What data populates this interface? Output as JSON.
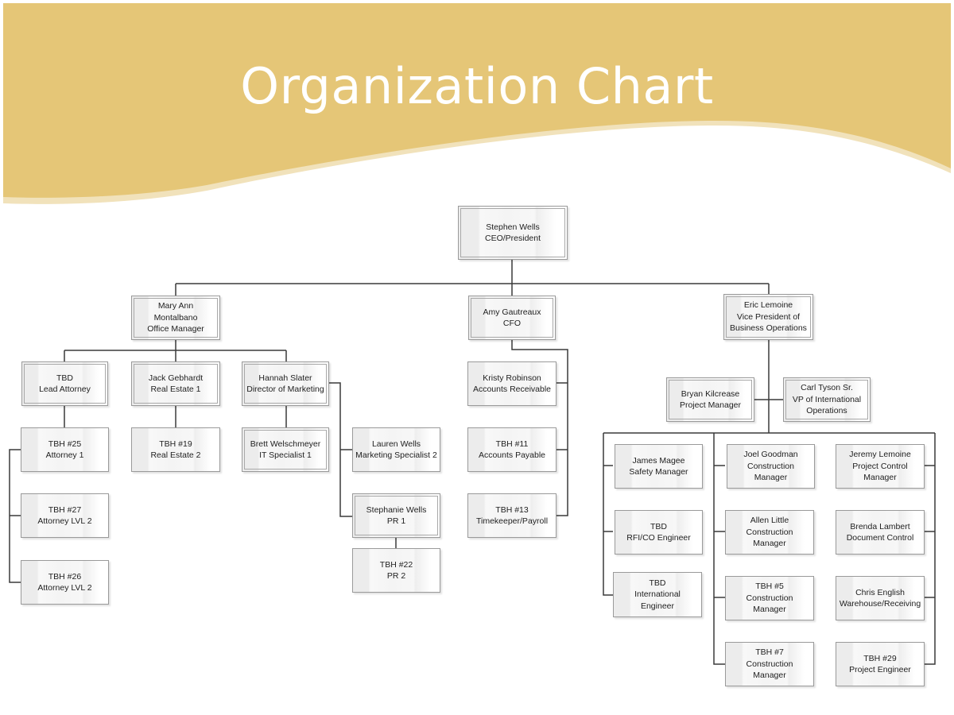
{
  "title": "Organization Chart",
  "colors": {
    "banner": "#e5c677",
    "banner_edge": "#f1e2bb",
    "connector": "#3a3a3a",
    "text": "#222222"
  },
  "nodes": [
    {
      "id": "ceo",
      "name": "Stephen Wells",
      "role": "CEO/President",
      "text": "Stephen Wells\nCEO/President"
    },
    {
      "id": "office-manager",
      "name": "Mary Ann Montalbano",
      "role": "Office Manager",
      "text": "Mary Ann\nMontalbano\nOffice Manager"
    },
    {
      "id": "cfo",
      "name": "Amy Gautreaux",
      "role": "CFO",
      "text": "Amy Gautreaux\nCFO"
    },
    {
      "id": "vp-business-ops",
      "name": "Eric Lemoine",
      "role": "Vice President of Business Operations",
      "text": "Eric Lemoine\nVice President of\nBusiness Operations"
    },
    {
      "id": "lead-attorney",
      "name": "TBD",
      "role": "Lead Attorney",
      "text": "TBD\nLead Attorney"
    },
    {
      "id": "real-estate-1",
      "name": "Jack Gebhardt",
      "role": "Real Estate 1",
      "text": "Jack Gebhardt\nReal Estate 1"
    },
    {
      "id": "director-marketing",
      "name": "Hannah Slater",
      "role": "Director of Marketing",
      "text": "Hannah Slater\nDirector of Marketing"
    },
    {
      "id": "attorney-1",
      "name": "TBH #25",
      "role": "Attorney 1",
      "text": "TBH #25\nAttorney 1"
    },
    {
      "id": "attorney-lvl2-a",
      "name": "TBH #27",
      "role": "Attorney LVL 2",
      "text": "TBH #27\nAttorney LVL 2"
    },
    {
      "id": "attorney-lvl2-b",
      "name": "TBH #26",
      "role": "Attorney LVL 2",
      "text": "TBH #26\nAttorney LVL 2"
    },
    {
      "id": "real-estate-2",
      "name": "TBH #19",
      "role": "Real Estate 2",
      "text": "TBH #19\nReal Estate 2"
    },
    {
      "id": "it-specialist",
      "name": "Brett Welschmeyer",
      "role": "IT Specialist 1",
      "text": "Brett Welschmeyer\nIT Specialist 1"
    },
    {
      "id": "marketing-specialist",
      "name": "Lauren Wells",
      "role": "Marketing Specialist 2",
      "text": "Lauren Wells\nMarketing Specialist 2"
    },
    {
      "id": "pr-1",
      "name": "Stephanie Wells",
      "role": "PR 1",
      "text": "Stephanie Wells\nPR 1"
    },
    {
      "id": "pr-2",
      "name": "TBH #22",
      "role": "PR 2",
      "text": "TBH #22\nPR 2"
    },
    {
      "id": "accounts-receivable",
      "name": "Kristy Robinson",
      "role": "Accounts Receivable",
      "text": "Kristy Robinson\nAccounts Receivable"
    },
    {
      "id": "accounts-payable",
      "name": "TBH #11",
      "role": "Accounts Payable",
      "text": "TBH #11\nAccounts Payable"
    },
    {
      "id": "timekeeper",
      "name": "TBH #13",
      "role": "Timekeeper/Payroll",
      "text": "TBH #13\nTimekeeper/Payroll"
    },
    {
      "id": "project-manager",
      "name": "Bryan Kilcrease",
      "role": "Project Manager",
      "text": "Bryan Kilcrease\nProject Manager"
    },
    {
      "id": "vp-international",
      "name": "Carl Tyson Sr.",
      "role": "VP of International Operations",
      "text": "Carl Tyson Sr.\nVP of International\nOperations"
    },
    {
      "id": "safety-manager",
      "name": "James Magee",
      "role": "Safety Manager",
      "text": "James Magee\nSafety Manager"
    },
    {
      "id": "rfi-engineer",
      "name": "TBD",
      "role": "RFI/CO Engineer",
      "text": "TBD\nRFI/CO Engineer"
    },
    {
      "id": "international-engineer",
      "name": "TBD",
      "role": "International Engineer",
      "text": "TBD\nInternational\nEngineer"
    },
    {
      "id": "construction-manager-joel",
      "name": "Joel Goodman",
      "role": "Construction Manager",
      "text": "Joel Goodman\nConstruction\nManager"
    },
    {
      "id": "construction-manager-allen",
      "name": "Allen Little",
      "role": "Construction Manager",
      "text": "Allen Little\nConstruction\nManager"
    },
    {
      "id": "construction-manager-tbh5",
      "name": "TBH #5",
      "role": "Construction Manager",
      "text": "TBH #5\nConstruction\nManager"
    },
    {
      "id": "construction-manager-tbh7",
      "name": "TBH #7",
      "role": "Construction Manager",
      "text": "TBH #7\nConstruction\nManager"
    },
    {
      "id": "project-control-manager",
      "name": "Jeremy Lemoine",
      "role": "Project Control Manager",
      "text": "Jeremy Lemoine\nProject Control\nManager"
    },
    {
      "id": "document-control",
      "name": "Brenda Lambert",
      "role": "Document Control",
      "text": "Brenda Lambert\nDocument Control"
    },
    {
      "id": "warehouse-receiving",
      "name": "Chris English",
      "role": "Warehouse/Receiving",
      "text": "Chris English\nWarehouse/Receiving"
    },
    {
      "id": "project-engineer",
      "name": "TBH #29",
      "role": "Project Engineer",
      "text": "TBH #29\nProject Engineer"
    }
  ]
}
